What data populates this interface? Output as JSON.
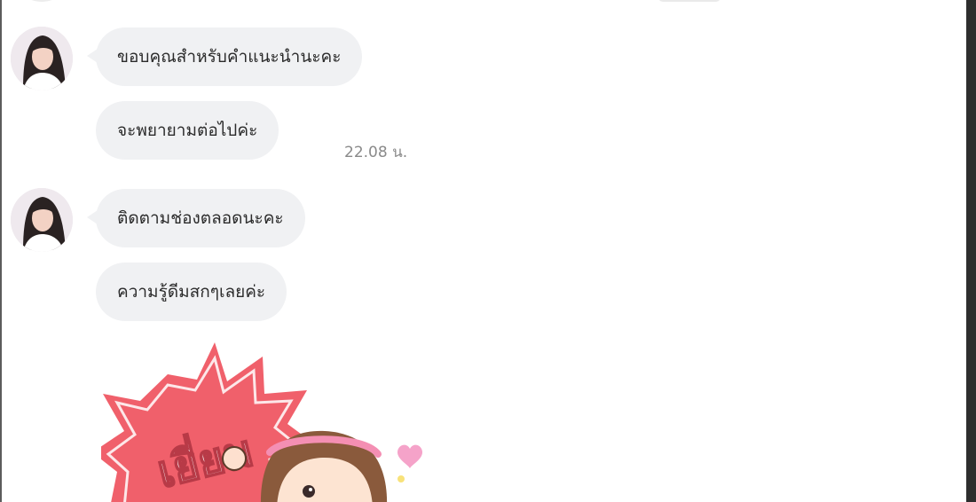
{
  "messages": [
    {
      "text": "ขอบคุณสำหรับคำแนะนำนะคะ"
    },
    {
      "text": "จะพยายามต่อไปค่ะ",
      "time": "22.08 น."
    },
    {
      "text": "ติดตามช่องตลอดนะคะ"
    },
    {
      "text": "ความรู้ดีมสกๆเลยค่ะ"
    }
  ],
  "sticker": {
    "text": "เยี่ยม",
    "icon": "heart-icon"
  },
  "colors": {
    "bubble": "#f0f1f3",
    "sticker_burst": "#f0606b",
    "sticker_heart": "#f5a3c9"
  }
}
